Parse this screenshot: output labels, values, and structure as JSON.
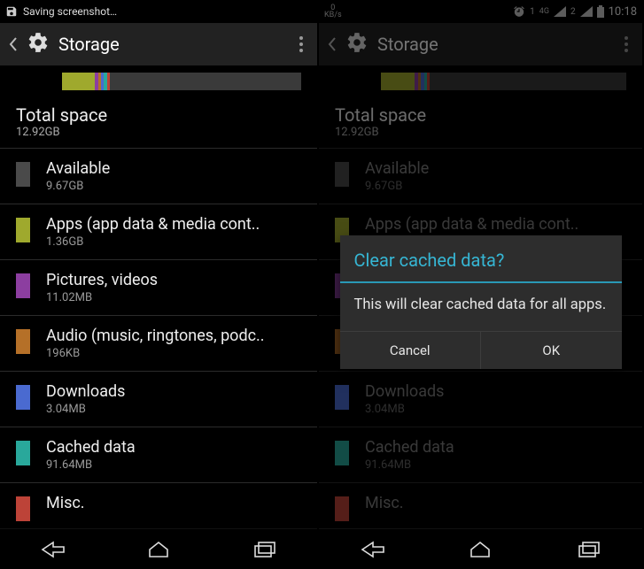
{
  "left": {
    "status_text": "Saving screenshot…",
    "actionbar": {
      "title": "Storage"
    },
    "total": {
      "title": "Total space",
      "value": "12.92GB"
    },
    "rows": [
      {
        "label": "Available",
        "value": "9.67GB",
        "color": "#4a4a4a"
      },
      {
        "label": "Apps (app data & media cont..",
        "value": "1.36GB",
        "color": "#9fa92d"
      },
      {
        "label": "Pictures, videos",
        "value": "11.02MB",
        "color": "#8c3ea0"
      },
      {
        "label": "Audio (music, ringtones, podc..",
        "value": "196KB",
        "color": "#b57028"
      },
      {
        "label": "Downloads",
        "value": "3.04MB",
        "color": "#4a6ad0"
      },
      {
        "label": "Cached data",
        "value": "91.64MB",
        "color": "#29a89b"
      },
      {
        "label": "Misc.",
        "value": "",
        "color": "#bd4338"
      }
    ],
    "usage_segments": [
      {
        "color": "#9fa92d",
        "flex": 11
      },
      {
        "color": "#8c3ea0",
        "flex": 1
      },
      {
        "color": "#b57028",
        "flex": 1
      },
      {
        "color": "#4a6ad0",
        "flex": 1
      },
      {
        "color": "#29a89b",
        "flex": 1
      },
      {
        "color": "#bd4338",
        "flex": 1
      },
      {
        "color": "#3a3a3a",
        "flex": 64
      }
    ]
  },
  "right": {
    "status": {
      "net": "0",
      "net_unit": "KB/s",
      "time": "10:18",
      "alarm_count": "1"
    },
    "actionbar": {
      "title": "Storage"
    },
    "total": {
      "title": "Total space",
      "value": "12.92GB"
    },
    "rows": [
      {
        "label": "Available",
        "value": "9.67GB",
        "color": "#4a4a4a"
      },
      {
        "label": "Apps (app data & media cont..",
        "value": "1.36GB",
        "color": "#9fa92d"
      },
      {
        "label": "Pictures, videos",
        "value": "11.02MB",
        "color": "#8c3ea0"
      },
      {
        "label": "Audio (music, ringtones, podc..",
        "value": "196KB",
        "color": "#b57028"
      },
      {
        "label": "Downloads",
        "value": "3.04MB",
        "color": "#4a6ad0"
      },
      {
        "label": "Cached data",
        "value": "91.64MB",
        "color": "#29a89b"
      },
      {
        "label": "Misc.",
        "value": "",
        "color": "#bd4338"
      }
    ],
    "usage_segments": [
      {
        "color": "#9fa92d",
        "flex": 11
      },
      {
        "color": "#8c3ea0",
        "flex": 1
      },
      {
        "color": "#b57028",
        "flex": 1
      },
      {
        "color": "#4a6ad0",
        "flex": 1
      },
      {
        "color": "#29a89b",
        "flex": 1
      },
      {
        "color": "#bd4338",
        "flex": 1
      },
      {
        "color": "#3a3a3a",
        "flex": 64
      }
    ],
    "dialog": {
      "title": "Clear cached data?",
      "message": "This will clear cached data for all apps.",
      "cancel": "Cancel",
      "ok": "OK"
    }
  }
}
